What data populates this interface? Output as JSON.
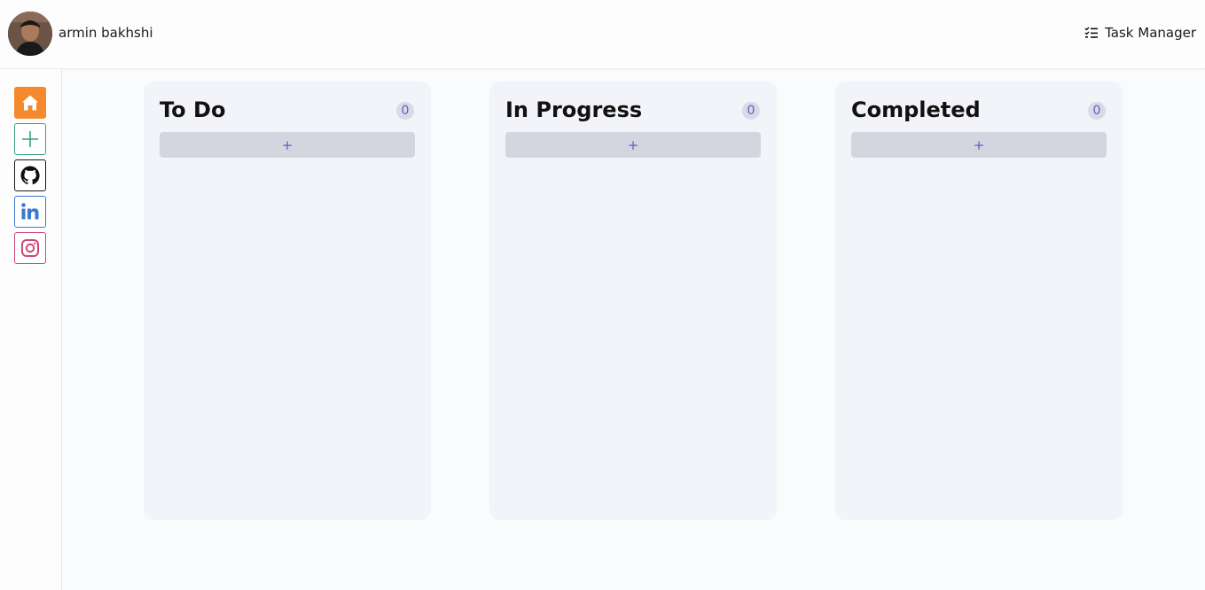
{
  "header": {
    "user_name": "armin bakhshi",
    "brand_label": "Task Manager",
    "brand_icon": "task-list-icon"
  },
  "sidebar": {
    "items": [
      {
        "name": "home",
        "icon": "home-icon",
        "color": "#f5892d"
      },
      {
        "name": "add-task",
        "icon": "plus-icon",
        "color": "#3aa37a"
      },
      {
        "name": "github",
        "icon": "github-icon",
        "color": "#1a1a1a"
      },
      {
        "name": "linkedin",
        "icon": "linkedin-icon",
        "color": "#3a7bd0"
      },
      {
        "name": "instagram",
        "icon": "instagram-icon",
        "color": "#d0467a"
      }
    ]
  },
  "board": {
    "columns": [
      {
        "title": "To Do",
        "count": "0",
        "add_label": "+"
      },
      {
        "title": "In Progress",
        "count": "0",
        "add_label": "+"
      },
      {
        "title": "Completed",
        "count": "0",
        "add_label": "+"
      }
    ]
  },
  "colors": {
    "accent": "#5a5fc8",
    "column_bg": "#f2f4f9",
    "add_button_bg": "#d3d6de"
  }
}
